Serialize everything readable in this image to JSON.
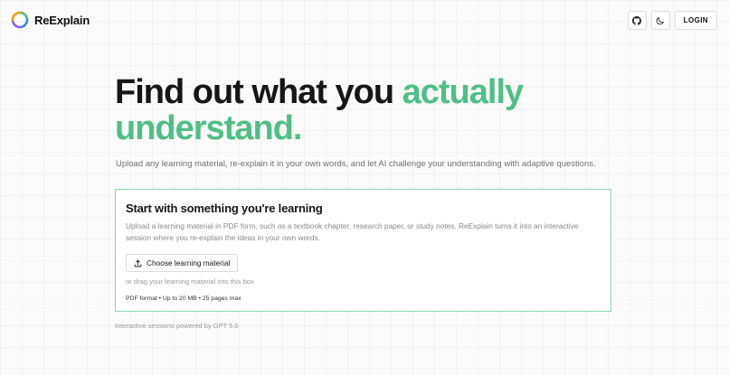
{
  "app": {
    "name": "ReExplain"
  },
  "header": {
    "login_label": "LOGIN",
    "icons": [
      "github-icon",
      "moon-icon"
    ]
  },
  "hero": {
    "title_plain": "Find out what you ",
    "title_accent_1": "actually",
    "title_accent_2": "understand."
  },
  "subtitle": "Upload any learning material, re-explain it in your own words, and let AI challenge your understanding with adaptive questions.",
  "upload_card": {
    "title": "Start with something you're learning",
    "description": "Upload a learning material in PDF form, such as a textbook chapter, research paper, or study notes. ReExplain turns it into an interactive session where you re-explain the ideas in your own words.",
    "choose_button_label": "Choose learning material",
    "drag_hint": "or drag your learning material into this box",
    "limits": "PDF format • Up to 20 MB • 25 pages max"
  },
  "footer_note": "Interactive sessions powered by GPT 5.6",
  "colors": {
    "accent": "#4fbf86",
    "card_border": "#8fd4b2"
  }
}
